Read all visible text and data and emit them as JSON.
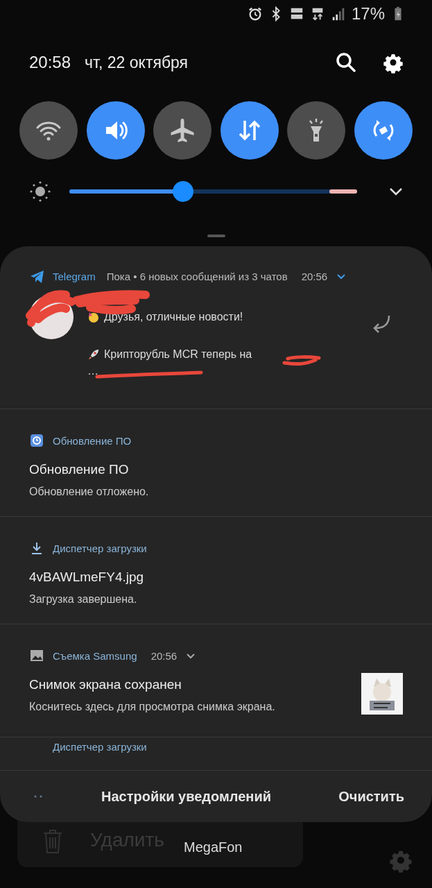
{
  "status_bar": {
    "battery": "17%"
  },
  "header": {
    "time": "20:58",
    "date": "чт, 22 октября"
  },
  "quick_toggles": [
    {
      "kind": "wifi",
      "on": false
    },
    {
      "kind": "sound",
      "on": true
    },
    {
      "kind": "airplane",
      "on": false
    },
    {
      "kind": "data",
      "on": true
    },
    {
      "kind": "flashlight",
      "on": false
    },
    {
      "kind": "rotate",
      "on": true
    }
  ],
  "brightness": {
    "level": 0.395
  },
  "notifications": [
    {
      "kind": "telegram",
      "app": "Telegram",
      "summary": "Пока • 6 новых сообщений из 3 чатов",
      "time": "20:56",
      "lines": [
        "Друзья, отличные новости!",
        "Крипторубль MCR теперь на",
        "…"
      ]
    },
    {
      "kind": "update",
      "app": "Обновление ПО",
      "title": "Обновление ПО",
      "text": "Обновление отложено."
    },
    {
      "kind": "download",
      "app": "Диспетчер загрузки",
      "title": "4vBAWLmeFY4.jpg",
      "text": "Загрузка завершена."
    },
    {
      "kind": "screenshot",
      "app": "Съемка Samsung",
      "time": "20:56",
      "title": "Снимок экрана сохранен",
      "text": "Коснитесь здесь для просмотра снимка экрана."
    },
    {
      "kind": "partial",
      "app": "Диспетчер загрузки"
    }
  ],
  "footer": {
    "settings": "Настройки уведомлений",
    "clear": "Очистить"
  },
  "background": {
    "delete": "Удалить",
    "carrier": "MegaFon"
  }
}
